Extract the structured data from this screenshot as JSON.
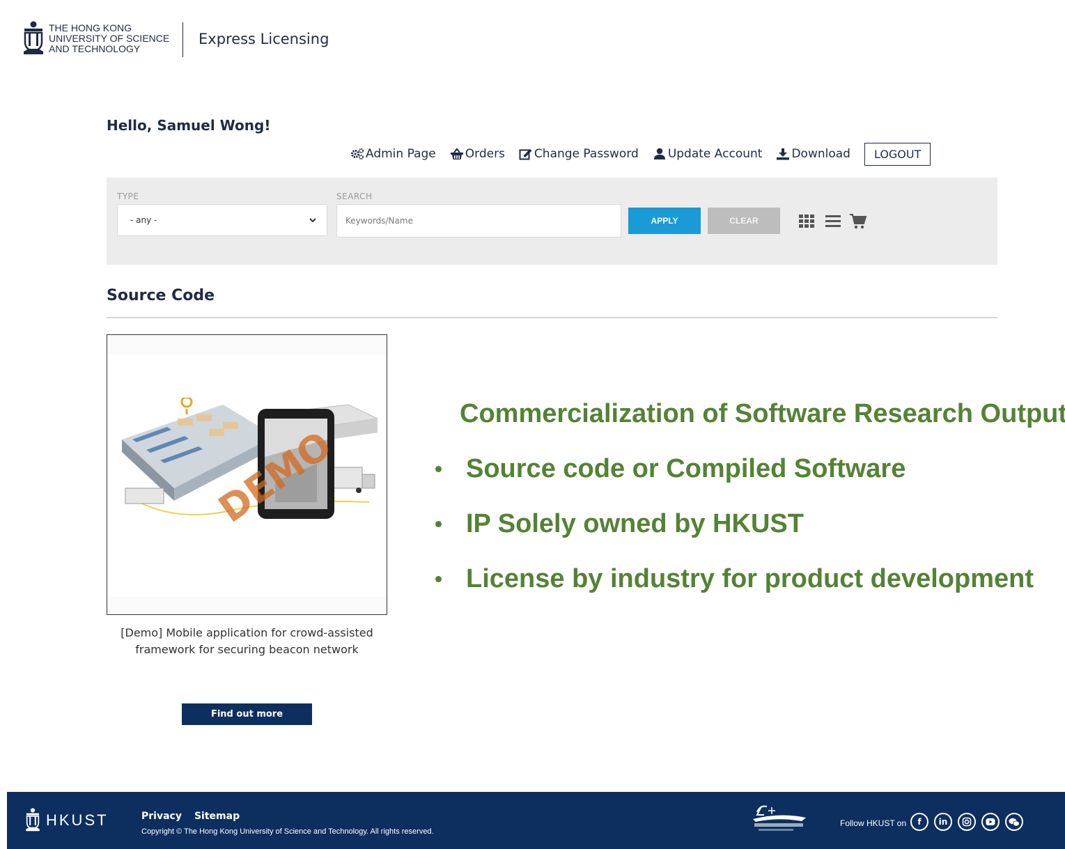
{
  "header": {
    "university_lines": [
      "THE HONG KONG",
      "UNIVERSITY OF SCIENCE",
      "AND TECHNOLOGY"
    ],
    "app_title": "Express Licensing"
  },
  "greeting": "Hello, Samuel Wong!",
  "nav": {
    "admin": "Admin Page",
    "orders": "Orders",
    "change_password": "Change Password",
    "update_account": "Update Account",
    "download": "Download",
    "logout": "LOGOUT"
  },
  "filter": {
    "type_label": "TYPE",
    "type_value": "- any -",
    "search_label": "SEARCH",
    "search_placeholder": "Keywords/Name",
    "apply": "APPLY",
    "clear": "CLEAR"
  },
  "section_title": "Source Code",
  "card": {
    "watermark": "DEMO",
    "description": "[Demo] Mobile application for crowd-assisted framework for securing beacon network",
    "button": "Find out more"
  },
  "bullets": [
    "Commercialization of Software Research Outputs",
    "Source code or Compiled Software",
    "IP Solely owned by HKUST",
    "License by industry for product development"
  ],
  "footer": {
    "brand": "HKUST",
    "privacy": "Privacy",
    "sitemap": "Sitemap",
    "copyright": "Copyright © The Hong Kong University of Science and Technology. All rights reserved.",
    "follow": "Follow HKUST on",
    "social": [
      "facebook-icon",
      "linkedin-icon",
      "instagram-icon",
      "youtube-icon",
      "wechat-icon"
    ]
  },
  "colors": {
    "navy": "#0c2f5f",
    "accent_blue": "#1a9ad6",
    "bullet_green": "#548235",
    "clear_gray": "#bdbdbd"
  }
}
